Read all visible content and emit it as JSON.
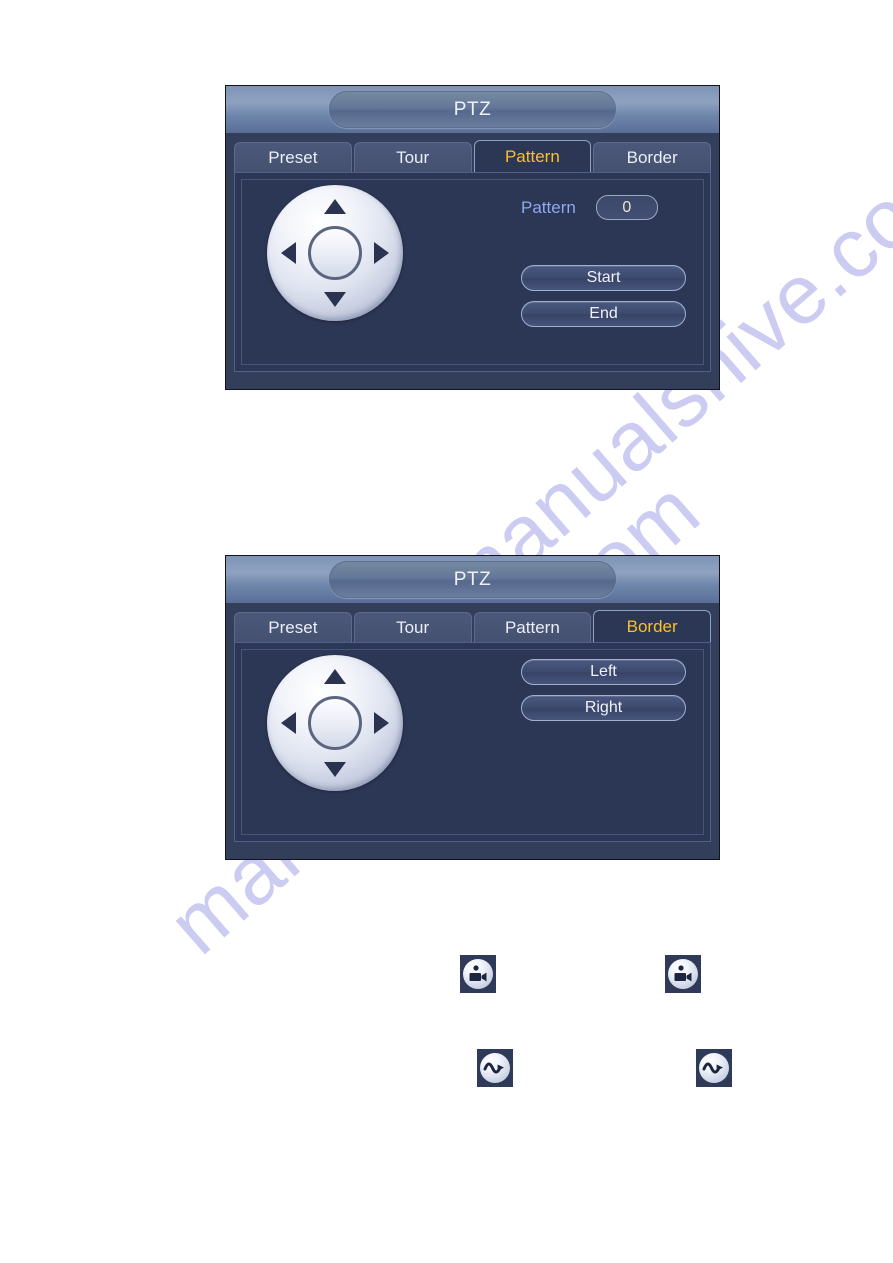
{
  "page": {
    "watermark": "manualshive.com",
    "watermark_color": "#ccccf2",
    "background": "#ffffff"
  },
  "panels": [
    {
      "id": "pattern",
      "title": "PTZ",
      "active_tab": "Pattern",
      "tabs": [
        {
          "label": "Preset",
          "active": false
        },
        {
          "label": "Tour",
          "active": false
        },
        {
          "label": "Pattern",
          "active": true
        },
        {
          "label": "Border",
          "active": false
        }
      ],
      "joystick": {
        "name": "direction-pad",
        "arrows": [
          "up",
          "down",
          "left",
          "right"
        ],
        "center": "confirm"
      },
      "field": {
        "label": "Pattern",
        "value": "0",
        "placeholder": "0"
      },
      "buttons": [
        {
          "label": "Start"
        },
        {
          "label": "End"
        }
      ]
    },
    {
      "id": "border",
      "title": "PTZ",
      "active_tab": "Border",
      "tabs": [
        {
          "label": "Preset",
          "active": false
        },
        {
          "label": "Tour",
          "active": false
        },
        {
          "label": "Pattern",
          "active": false
        },
        {
          "label": "Border",
          "active": true
        }
      ],
      "joystick": {
        "name": "direction-pad",
        "arrows": [
          "up",
          "down",
          "left",
          "right"
        ],
        "center": "confirm"
      },
      "buttons": [
        {
          "label": "Left"
        },
        {
          "label": "Right"
        }
      ]
    }
  ],
  "icons": [
    {
      "name": "camcorder-icon",
      "glyph": "camcorder",
      "position": "upper-left"
    },
    {
      "name": "camcorder-icon",
      "glyph": "camcorder",
      "position": "upper-right"
    },
    {
      "name": "pattern-wave-icon",
      "glyph": "wave-arrow",
      "position": "lower-left"
    },
    {
      "name": "pattern-wave-icon",
      "glyph": "wave-arrow",
      "position": "lower-right"
    }
  ],
  "colors": {
    "panel_body": "#2c3755",
    "panel_chrome": "#323e5a",
    "titlebar_top": "#8fa2c0",
    "tab_inactive": "#4c587a",
    "active_tab_text": "#f8c223",
    "label_text": "#8fa8f0",
    "button_border": "#9fb0d2",
    "input_text": "#e9e8d0"
  }
}
